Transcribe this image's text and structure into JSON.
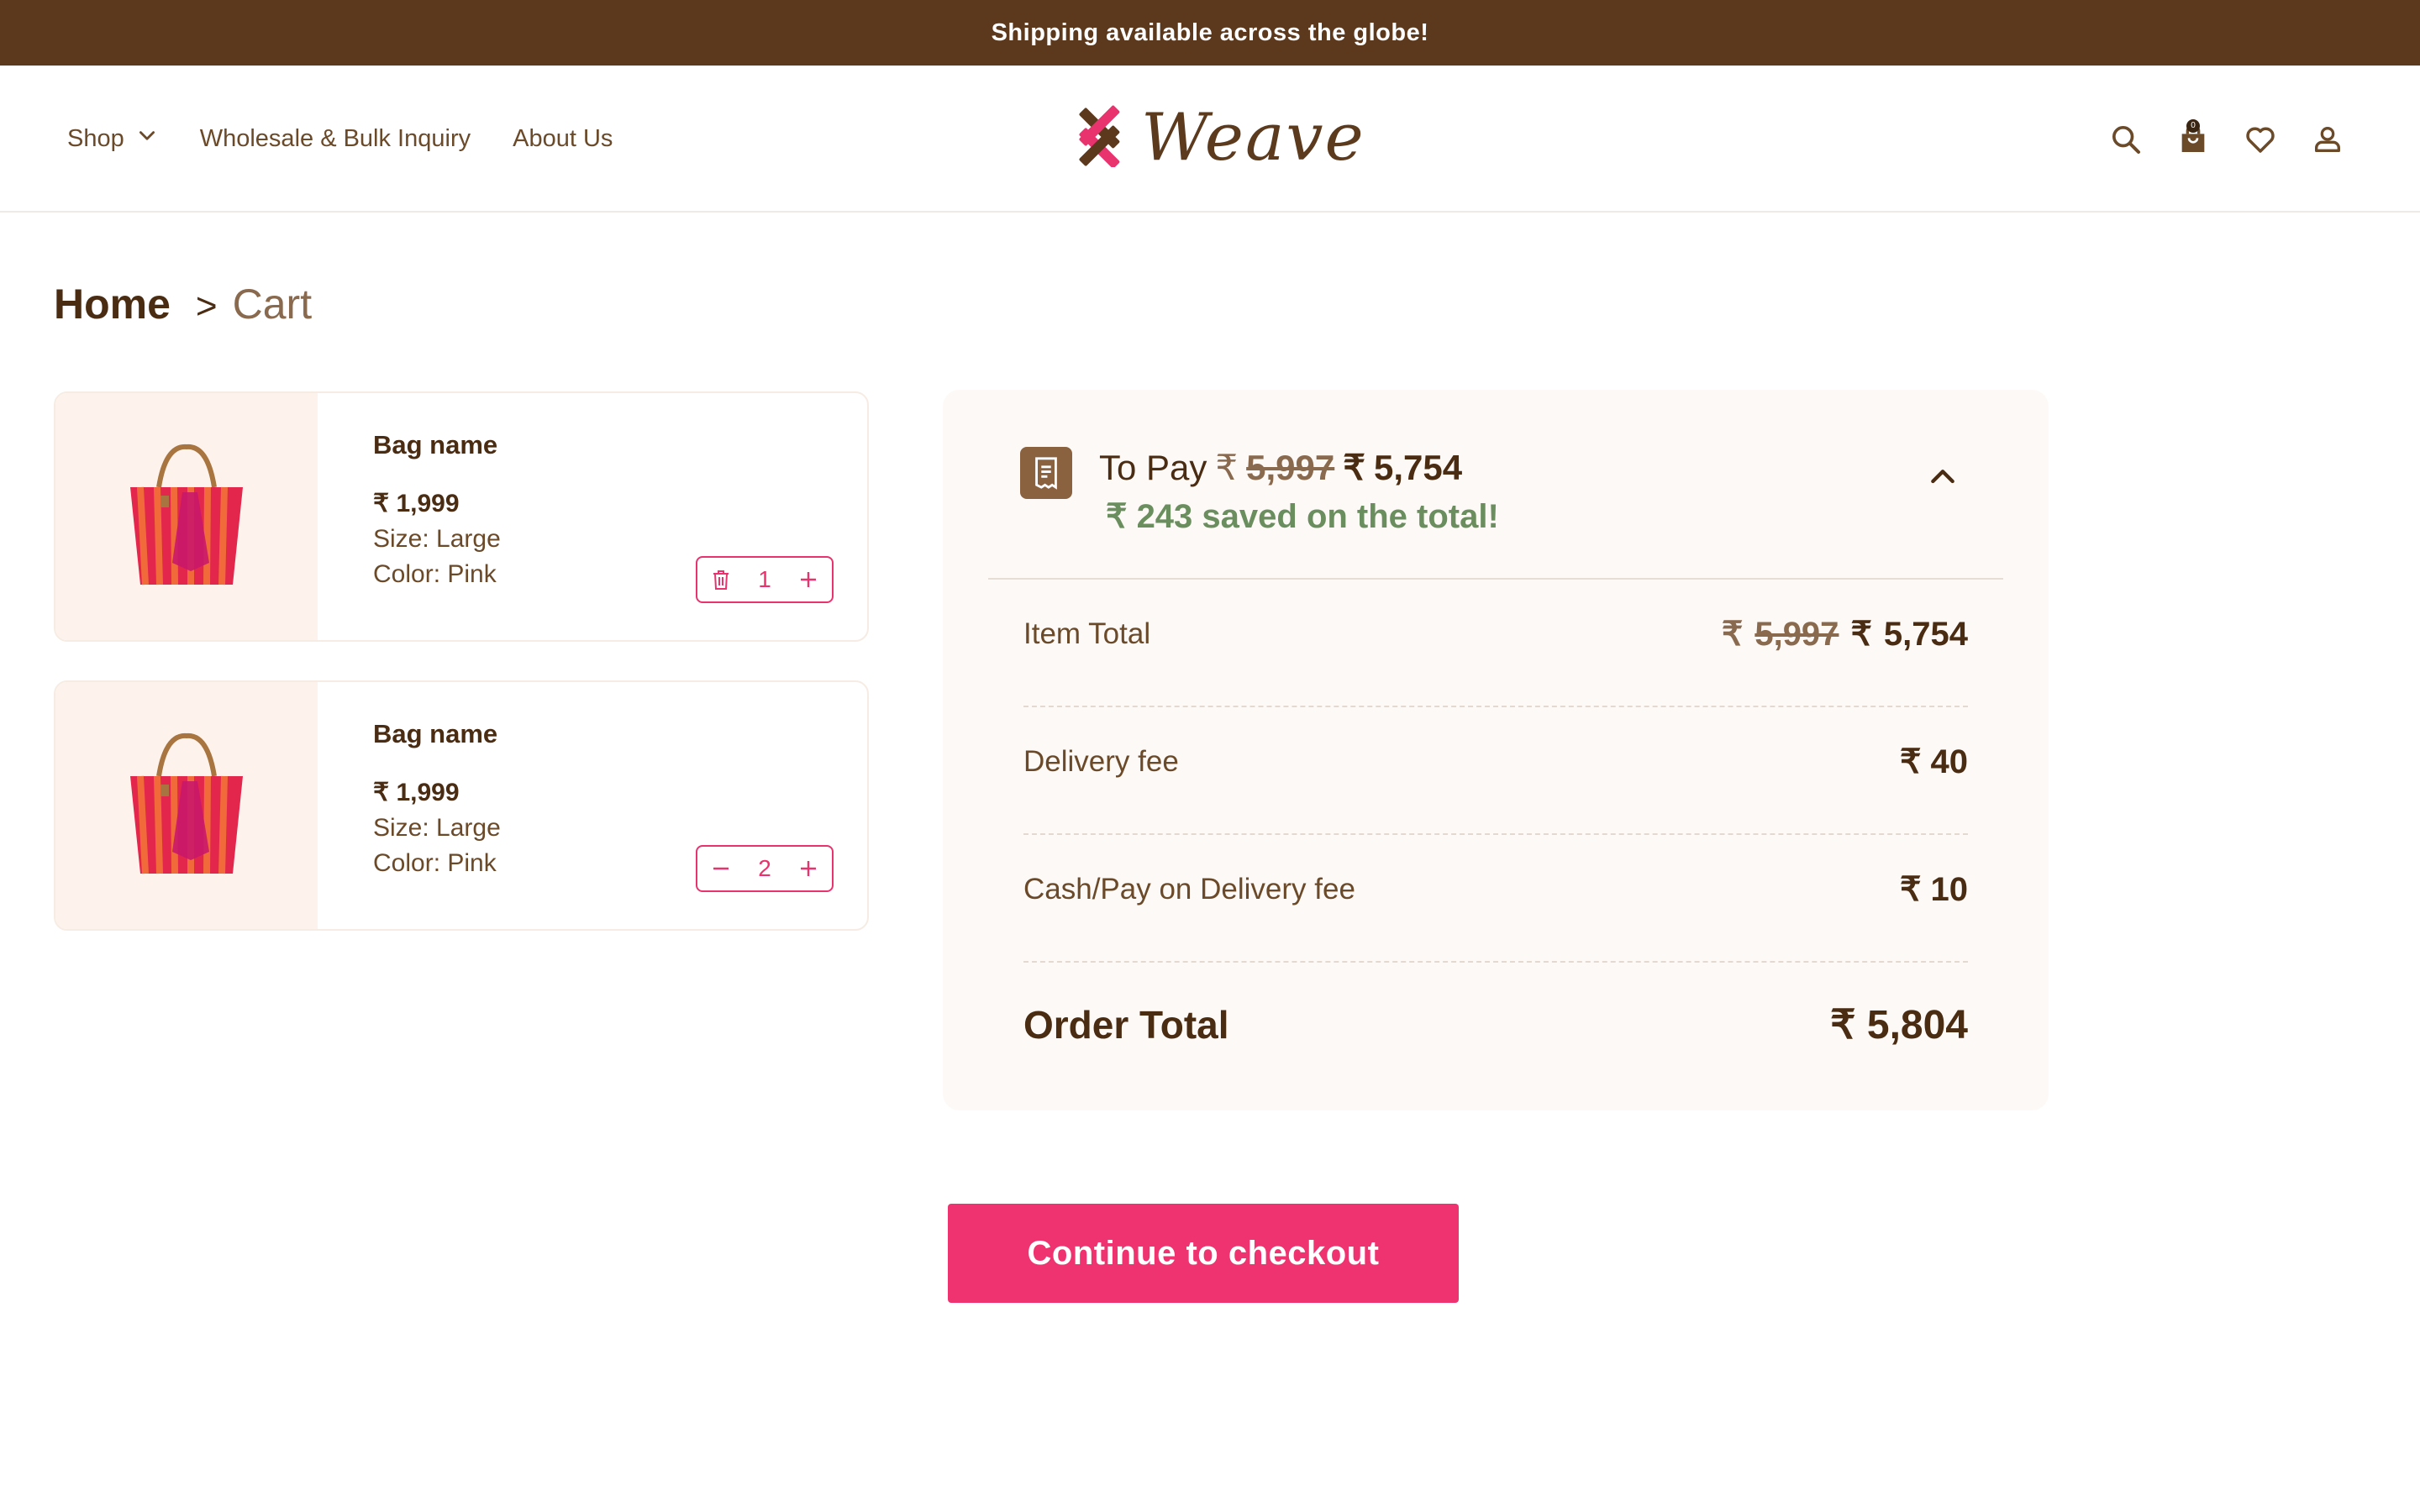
{
  "announcement": "Shipping available across the globe!",
  "nav": {
    "shop": "Shop",
    "wholesale": "Wholesale & Bulk Inquiry",
    "about": "About Us",
    "logo_text": "Weave",
    "cart_count": "0"
  },
  "breadcrumb": {
    "home": "Home",
    "separator": ">",
    "current": "Cart"
  },
  "cart_items": [
    {
      "name": "Bag name",
      "currency": "₹",
      "price": "1,999",
      "size": "Size: Large",
      "color": "Color: Pink",
      "quantity": "1"
    },
    {
      "name": "Bag name",
      "currency": "₹",
      "price": "1,999",
      "size": "Size: Large",
      "color": "Color: Pink",
      "quantity": "2"
    }
  ],
  "summary": {
    "to_pay_label": "To Pay",
    "currency": "₹",
    "original_total": "5,997",
    "discounted_total": "5,754",
    "saved_text": "₹ 243 saved on the total!",
    "item_total_label": "Item Total",
    "item_total_original": "5,997",
    "item_total": "5,754",
    "delivery_label": "Delivery fee",
    "delivery_value": "₹ 40",
    "cod_label": "Cash/Pay on Delivery fee",
    "cod_value": "₹ 10",
    "order_total_label": "Order Total",
    "order_total_value": "₹ 5,804"
  },
  "checkout_label": "Continue to checkout",
  "colors": {
    "brand_brown": "#5c391d",
    "accent_pink": "#ee3370",
    "saved_green": "#6a8e5e"
  }
}
